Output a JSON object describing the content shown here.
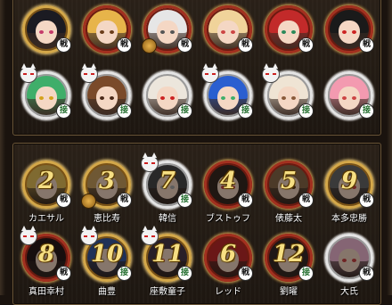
{
  "roster_top": [
    {
      "badge": "戦",
      "frame": "gold",
      "hair": "#1b1b22",
      "eye": "#c43a6a",
      "fox": false,
      "coin": false
    },
    {
      "badge": "戦",
      "frame": "red",
      "hair": "#e7b44a",
      "eye": "#6a3d1a",
      "fox": false,
      "coin": false
    },
    {
      "badge": "戦",
      "frame": "red",
      "hair": "#e6e6e6",
      "eye": "#555",
      "fox": false,
      "coin": true
    },
    {
      "badge": "戦",
      "frame": "red",
      "hair": "#f0d39a",
      "eye": "#c44",
      "fox": false,
      "coin": false
    },
    {
      "badge": "戦",
      "frame": "red",
      "hair": "#c22a2a",
      "eye": "#2a8a5a",
      "fox": false,
      "coin": false
    },
    {
      "badge": "戦",
      "frame": "red",
      "hair": "#1a1a1a",
      "eye": "#c22",
      "fox": false,
      "coin": false
    },
    {
      "badge": "接",
      "frame": "white",
      "hair": "#3fae6a",
      "eye": "#d4a21a",
      "fox": true,
      "coin": false
    },
    {
      "badge": "接",
      "frame": "white",
      "hair": "#7a4a2a",
      "eye": "#4a2a1a",
      "fox": true,
      "coin": false
    },
    {
      "badge": "接",
      "frame": "white",
      "hair": "#ece6dc",
      "eye": "#c22",
      "fox": false,
      "coin": false
    },
    {
      "badge": "接",
      "frame": "white",
      "hair": "#2a5fd0",
      "eye": "#3fae6a",
      "fox": true,
      "coin": false
    },
    {
      "badge": "接",
      "frame": "white",
      "hair": "#efe4d4",
      "eye": "#8a5a3a",
      "fox": true,
      "coin": false
    },
    {
      "badge": "接",
      "frame": "white",
      "hair": "#f39ab0",
      "eye": "#c44",
      "fox": false,
      "coin": false
    }
  ],
  "roster_bottom": [
    {
      "rank": "2",
      "badge": "戦",
      "name": "カエサル",
      "frame": "gold",
      "hair": "#e7c15a",
      "eye": "#5a3a1a",
      "fox": false,
      "coin": false
    },
    {
      "rank": "3",
      "badge": "戦",
      "name": "恵比寿",
      "frame": "gold",
      "hair": "#caa060",
      "eye": "#5a3a1a",
      "fox": false,
      "coin": true
    },
    {
      "rank": "7",
      "badge": "接",
      "name": "韓信",
      "frame": "white",
      "hair": "#4a4a4a",
      "eye": "#aaa",
      "fox": true,
      "coin": false
    },
    {
      "rank": "4",
      "badge": "戦",
      "name": "ブストゥフ",
      "frame": "red",
      "hair": "#3a2a22",
      "eye": "#c44",
      "fox": false,
      "coin": false
    },
    {
      "rank": "5",
      "badge": "戦",
      "name": "俵藤太",
      "frame": "red",
      "hair": "#8a6a4a",
      "eye": "#5a3a1a",
      "fox": false,
      "coin": false
    },
    {
      "rank": "9",
      "badge": "戦",
      "name": "本多忠勝",
      "frame": "gold",
      "hair": "#6a6a6a",
      "eye": "#c44",
      "fox": false,
      "coin": false
    },
    {
      "rank": "8",
      "badge": "戦",
      "name": "真田幸村",
      "frame": "red",
      "hair": "#2a1a1a",
      "eye": "#c44",
      "fox": true,
      "coin": false
    },
    {
      "rank": "10",
      "badge": "接",
      "name": "曲豊",
      "frame": "gold",
      "hair": "#3a5aa0",
      "eye": "#aaa",
      "fox": true,
      "coin": false
    },
    {
      "rank": "11",
      "badge": "接",
      "name": "座敷童子",
      "frame": "gold",
      "hair": "#4a3a4a",
      "eye": "#c44",
      "fox": true,
      "coin": false
    },
    {
      "rank": "6",
      "badge": "戦",
      "name": "レッド",
      "frame": "red",
      "hair": "#c22a2a",
      "eye": "#f6d27b",
      "fox": false,
      "coin": false
    },
    {
      "rank": "12",
      "badge": "接",
      "name": "劉曜",
      "frame": "red",
      "hair": "#3a2a2a",
      "eye": "#c44",
      "fox": false,
      "coin": false
    },
    {
      "rank": "",
      "badge": "戦",
      "name": "大氏",
      "frame": "white",
      "hair": "#f3b9d4",
      "eye": "#c44",
      "fox": false,
      "coin": false
    }
  ],
  "colors": {
    "rank_text": "#f6df83",
    "panel_border": "#6b5638",
    "background": "#1a130e"
  }
}
